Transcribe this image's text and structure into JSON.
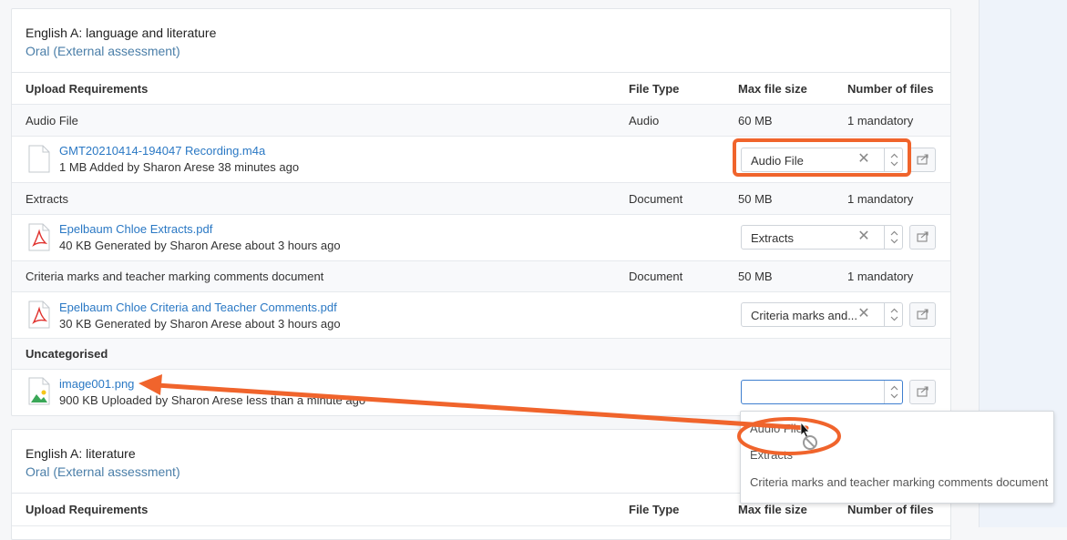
{
  "card1": {
    "title": "English A: language and literature",
    "subtitle": "Oral (External assessment)"
  },
  "columns": {
    "requirements": "Upload Requirements",
    "file_type": "File Type",
    "max_size": "Max file size",
    "num_files": "Number of files"
  },
  "requirements": [
    {
      "name": "Audio File",
      "type": "Audio",
      "size": "60 MB",
      "count": "1 mandatory",
      "file": {
        "name": "GMT20210414-194047 Recording.m4a",
        "meta": "1 MB Added by Sharon Arese 38 minutes ago",
        "icon": "document-icon",
        "category": "Audio File"
      }
    },
    {
      "name": "Extracts",
      "type": "Document",
      "size": "50 MB",
      "count": "1 mandatory",
      "file": {
        "name": "Epelbaum Chloe Extracts.pdf",
        "meta": "40 KB Generated by Sharon Arese about 3 hours ago",
        "icon": "pdf-icon",
        "category": "Extracts"
      }
    },
    {
      "name": "Criteria marks and teacher marking comments document",
      "type": "Document",
      "size": "50 MB",
      "count": "1 mandatory",
      "file": {
        "name": "Epelbaum Chloe Criteria and Teacher Comments.pdf",
        "meta": "30 KB Generated by Sharon Arese about 3 hours ago",
        "icon": "pdf-icon",
        "category": "Criteria marks and..."
      }
    }
  ],
  "uncategorised": {
    "label": "Uncategorised",
    "file": {
      "name": "image001.png",
      "meta": "900 KB Uploaded by Sharon Arese less than a minute ago",
      "icon": "image-icon",
      "category": ""
    }
  },
  "dropdown": {
    "options": [
      "Audio File",
      "Extracts",
      "Criteria marks and teacher marking comments document"
    ]
  },
  "card2": {
    "title": "English A: literature",
    "subtitle": "Oral (External assessment)"
  },
  "colors": {
    "link": "#2a78c4",
    "subtitle": "#4a7ea8",
    "highlight": "#f0642c",
    "focus": "#3f7fcf"
  }
}
